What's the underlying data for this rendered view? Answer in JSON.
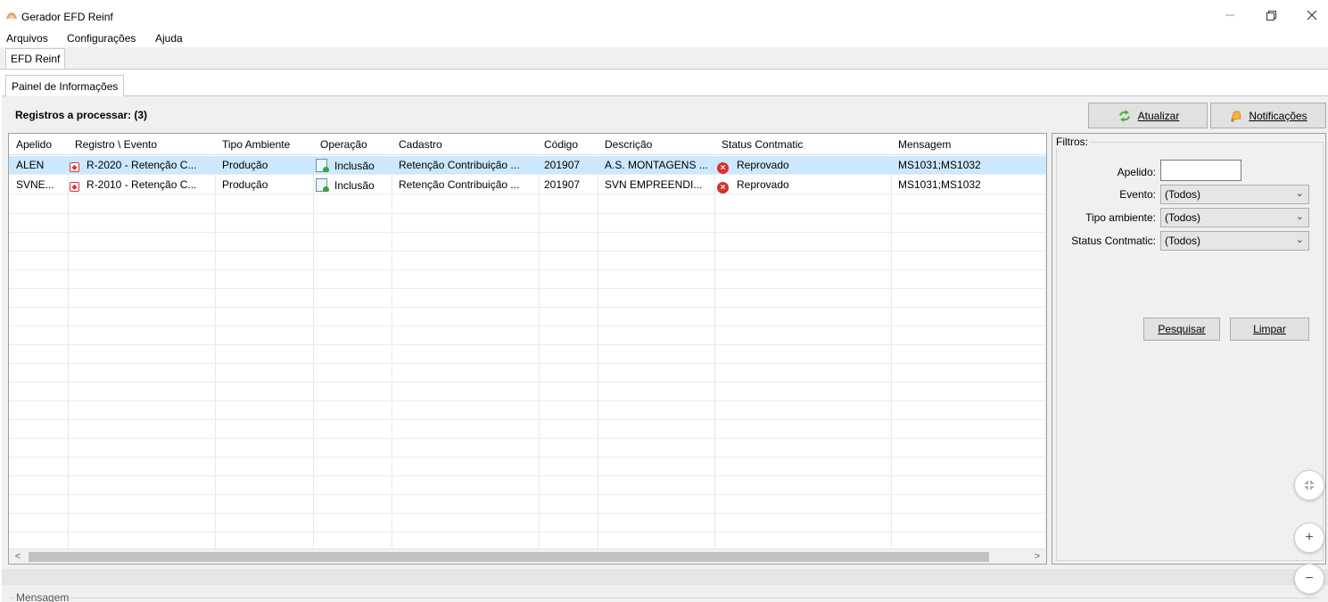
{
  "window": {
    "title": "Gerador EFD Reinf"
  },
  "menu": {
    "items": [
      "Arquivos",
      "Configurações",
      "Ajuda"
    ]
  },
  "tabs": {
    "outer": "EFD Reinf",
    "inner": "Painel de Informações"
  },
  "panel": {
    "title": "Registros a processar: (3)"
  },
  "toolbar": {
    "atualizar_label": "Atualizar",
    "notificacoes_label": "Notificações"
  },
  "grid": {
    "columns": [
      "Apelido",
      "Registro \\ Evento",
      "Tipo Ambiente",
      "Operação",
      "Cadastro",
      "Código",
      "Descrição",
      "Status Contmatic",
      "Mensagem"
    ],
    "rows": [
      {
        "apelido": "ALEN",
        "evento": "R-2020 - Retenção C...",
        "ambiente": "Produção",
        "operacao": "Inclusão",
        "cadastro": "Retenção Contribuição ...",
        "codigo": "201907",
        "descricao": "A.S. MONTAGENS ...",
        "status": "Reprovado",
        "mensagem": "MS1031;MS1032"
      },
      {
        "apelido": "SVNE...",
        "evento": "R-2010 - Retenção C...",
        "ambiente": "Produção",
        "operacao": "Inclusão",
        "cadastro": "Retenção Contribuição ...",
        "codigo": "201907",
        "descricao": "SVN EMPREENDI...",
        "status": "Reprovado",
        "mensagem": "MS1031;MS1032"
      }
    ]
  },
  "filters": {
    "legend": "Filtros:",
    "apelido_label": "Apelido:",
    "apelido_value": "",
    "evento_label": "Evento:",
    "evento_value": "(Todos)",
    "ambiente_label": "Tipo ambiente:",
    "ambiente_value": "(Todos)",
    "status_label": "Status Contmatic:",
    "status_value": "(Todos)",
    "pesquisar_label": "Pesquisar",
    "limpar_label": "Limpar"
  },
  "message_section": {
    "legend": "Mensagem"
  },
  "icons": {
    "refresh": "refresh-icon",
    "bell": "bell-icon",
    "event": "event-icon",
    "document": "document-icon",
    "error": "error-icon"
  },
  "colors": {
    "selection": "#cce8ff",
    "error": "#d9302c"
  }
}
